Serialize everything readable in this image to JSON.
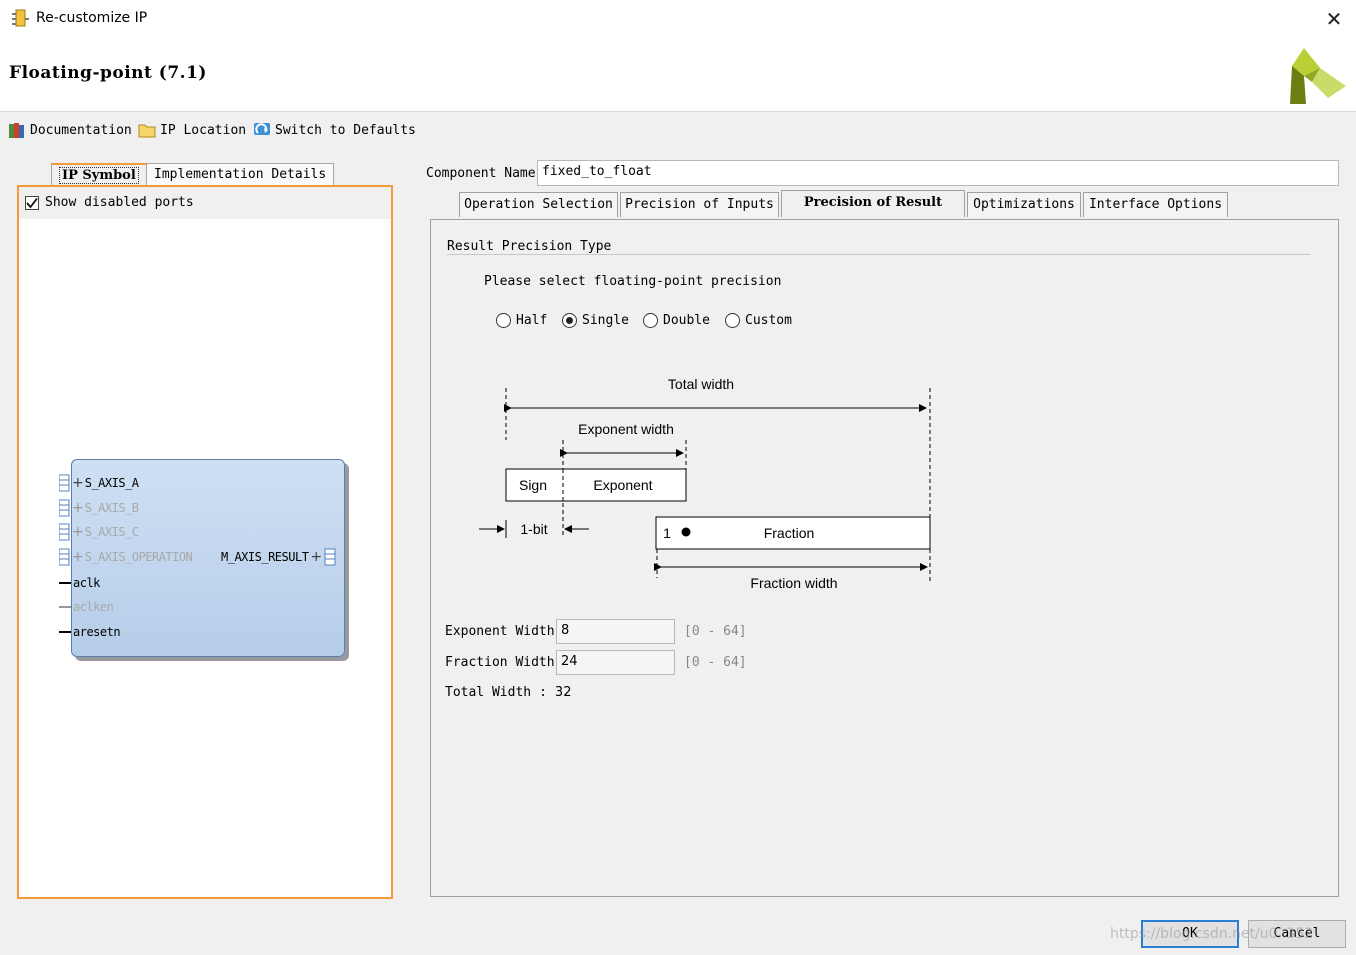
{
  "window": {
    "title": "Re-customize IP",
    "close_glyph": "✕"
  },
  "header": {
    "title": "Floating-point (7.1)",
    "logo_icon": "xilinx-logo"
  },
  "toolbar": {
    "documentation": "Documentation",
    "ip_location": "IP Location",
    "switch_defaults": "Switch to Defaults"
  },
  "left_tabs": {
    "ip_symbol": "IP Symbol",
    "impl_details": "Implementation Details"
  },
  "left_panel": {
    "show_disabled_ports": "Show disabled ports",
    "show_disabled_ports_checked": true,
    "ports_left": [
      {
        "name": "S_AXIS_A",
        "enabled": true,
        "bus": true
      },
      {
        "name": "S_AXIS_B",
        "enabled": false,
        "bus": true
      },
      {
        "name": "S_AXIS_C",
        "enabled": false,
        "bus": true
      },
      {
        "name": "S_AXIS_OPERATION",
        "enabled": false,
        "bus": true
      },
      {
        "name": "aclk",
        "enabled": true,
        "bus": false
      },
      {
        "name": "aclken",
        "enabled": false,
        "bus": false
      },
      {
        "name": "aresetn",
        "enabled": true,
        "bus": false
      }
    ],
    "port_right": "M_AXIS_RESULT"
  },
  "component": {
    "label": "Component Name",
    "value": "fixed_to_float"
  },
  "right_tabs": [
    {
      "label": "Operation Selection",
      "active": false
    },
    {
      "label": "Precision of Inputs",
      "active": false
    },
    {
      "label": "Precision of Result",
      "active": true
    },
    {
      "label": "Optimizations",
      "active": false
    },
    {
      "label": "Interface Options",
      "active": false
    }
  ],
  "result_precision": {
    "group_title": "Result Precision Type",
    "prompt": "Please select floating-point precision",
    "options": [
      "Half",
      "Single",
      "Double",
      "Custom"
    ],
    "selected": "Single"
  },
  "diagram": {
    "total_width": "Total width",
    "exponent_width": "Exponent width",
    "sign": "Sign",
    "exponent": "Exponent",
    "one_bit": "1-bit",
    "one": "1",
    "fraction": "Fraction",
    "fraction_width": "Fraction width"
  },
  "fields": {
    "exponent_width_label": "Exponent Width",
    "exponent_width_value": "8",
    "exponent_width_range": "[0 - 64]",
    "fraction_width_label": "Fraction Width",
    "fraction_width_value": "24",
    "fraction_width_range": "[0 - 64]",
    "total_width_label": "Total Width",
    "total_width_sep": ":",
    "total_width_value": "32"
  },
  "buttons": {
    "ok": "OK",
    "cancel": "Cancel"
  },
  "watermark": "https://blog.csdn.net/u0..352"
}
